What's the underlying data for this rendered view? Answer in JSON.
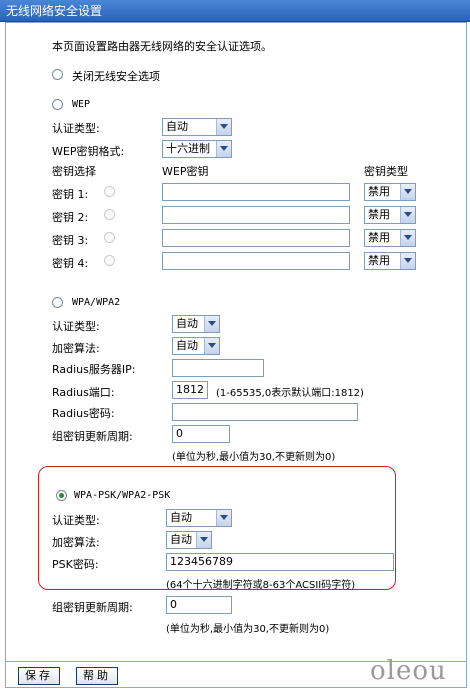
{
  "window": {
    "title": "无线网络安全设置"
  },
  "intro": "本页面设置路由器无线网络的安全认证选项。",
  "off_option": {
    "label": "关闭无线安全选项"
  },
  "wep": {
    "label": "WEP",
    "auth_label": "认证类型:",
    "auth_value": "自动",
    "format_label": "WEP密钥格式:",
    "format_value": "十六进制",
    "col_select": "密钥选择",
    "col_key": "WEP密钥",
    "col_type": "密钥类型",
    "keys": [
      {
        "label": "密钥 1:",
        "type": "禁用",
        "value": ""
      },
      {
        "label": "密钥 2:",
        "type": "禁用",
        "value": ""
      },
      {
        "label": "密钥 3:",
        "type": "禁用",
        "value": ""
      },
      {
        "label": "密钥 4:",
        "type": "禁用",
        "value": ""
      }
    ]
  },
  "wpa": {
    "label": "WPA/WPA2",
    "auth_label": "认证类型:",
    "auth_value": "自动",
    "algo_label": "加密算法:",
    "algo_value": "自动",
    "radius_ip_label": "Radius服务器IP:",
    "radius_ip_value": "",
    "radius_port_label": "Radius端口:",
    "radius_port_value": "1812",
    "radius_port_hint": "(1-65535,0表示默认端口:1812)",
    "radius_pwd_label": "Radius密码:",
    "radius_pwd_value": "",
    "rekey_label": "组密钥更新周期:",
    "rekey_value": "0",
    "rekey_hint": "(单位为秒,最小值为30,不更新则为0)"
  },
  "psk": {
    "label": "WPA-PSK/WPA2-PSK",
    "auth_label": "认证类型:",
    "auth_value": "自动",
    "algo_label": "加密算法:",
    "algo_value": "自动",
    "pwd_label": "PSK密码:",
    "pwd_value": "123456789",
    "pwd_hint": "(64个十六进制字符或8-63个ACSII码字符)",
    "rekey_label": "组密钥更新周期:",
    "rekey_value": "0",
    "rekey_hint": "(单位为秒,最小值为30,不更新则为0)"
  },
  "buttons": {
    "save": "保存",
    "help": "帮助"
  },
  "watermark": "oleou"
}
